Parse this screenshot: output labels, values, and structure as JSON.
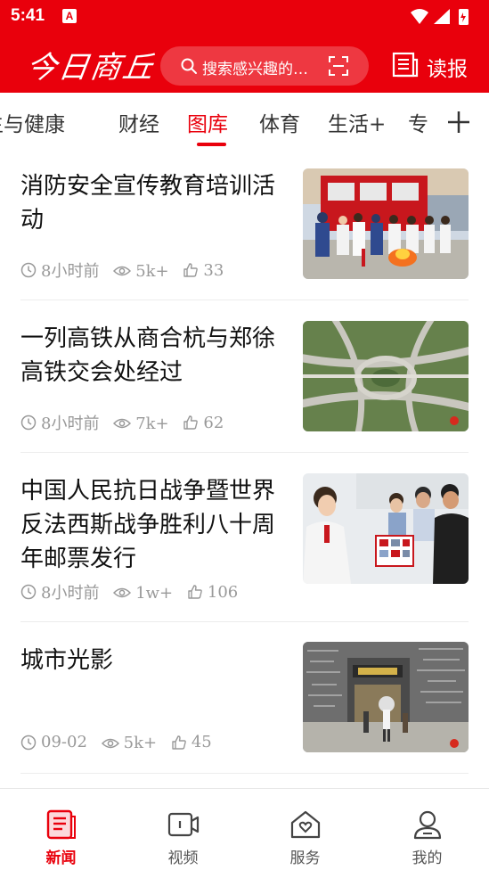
{
  "status_bar": {
    "time": "5:41",
    "notification_glyph": "A"
  },
  "header": {
    "logo_text": "今日商丘",
    "search_placeholder": "搜索感兴趣的…",
    "read_label": "读报"
  },
  "tabs": [
    {
      "label": "卫生与健康",
      "active": false
    },
    {
      "label": "财经",
      "active": false
    },
    {
      "label": "图库",
      "active": true
    },
    {
      "label": "体育",
      "active": false
    },
    {
      "label": "生活+",
      "active": false
    },
    {
      "label": "专",
      "active": false
    }
  ],
  "news": [
    {
      "title": "消防安全宣传教育培训活动",
      "time": "8小时前",
      "views": "5k+",
      "likes": "33",
      "image": "firefighter-training-photo"
    },
    {
      "title": "一列高铁从商合杭与郑徐高铁交会处经过",
      "time": "8小时前",
      "views": "7k+",
      "likes": "62",
      "image": "highway-interchange-aerial-photo"
    },
    {
      "title": "中国人民抗日战争暨世界反法西斯战争胜利八十周年邮票发行",
      "time": "8小时前",
      "views": "1w+",
      "likes": "106",
      "image": "stamp-release-photo"
    },
    {
      "title": "城市光影",
      "time": "09-02",
      "views": "5k+",
      "likes": "45",
      "image": "city-street-photo"
    }
  ],
  "bottom_nav": [
    {
      "label": "新闻",
      "icon": "news-icon",
      "active": true
    },
    {
      "label": "视频",
      "icon": "video-icon",
      "active": false
    },
    {
      "label": "服务",
      "icon": "service-home-icon",
      "active": false
    },
    {
      "label": "我的",
      "icon": "profile-icon",
      "active": false
    }
  ],
  "colors": {
    "brand_red": "#e9000c",
    "text_dark": "#111111",
    "meta_gray": "#999999"
  }
}
